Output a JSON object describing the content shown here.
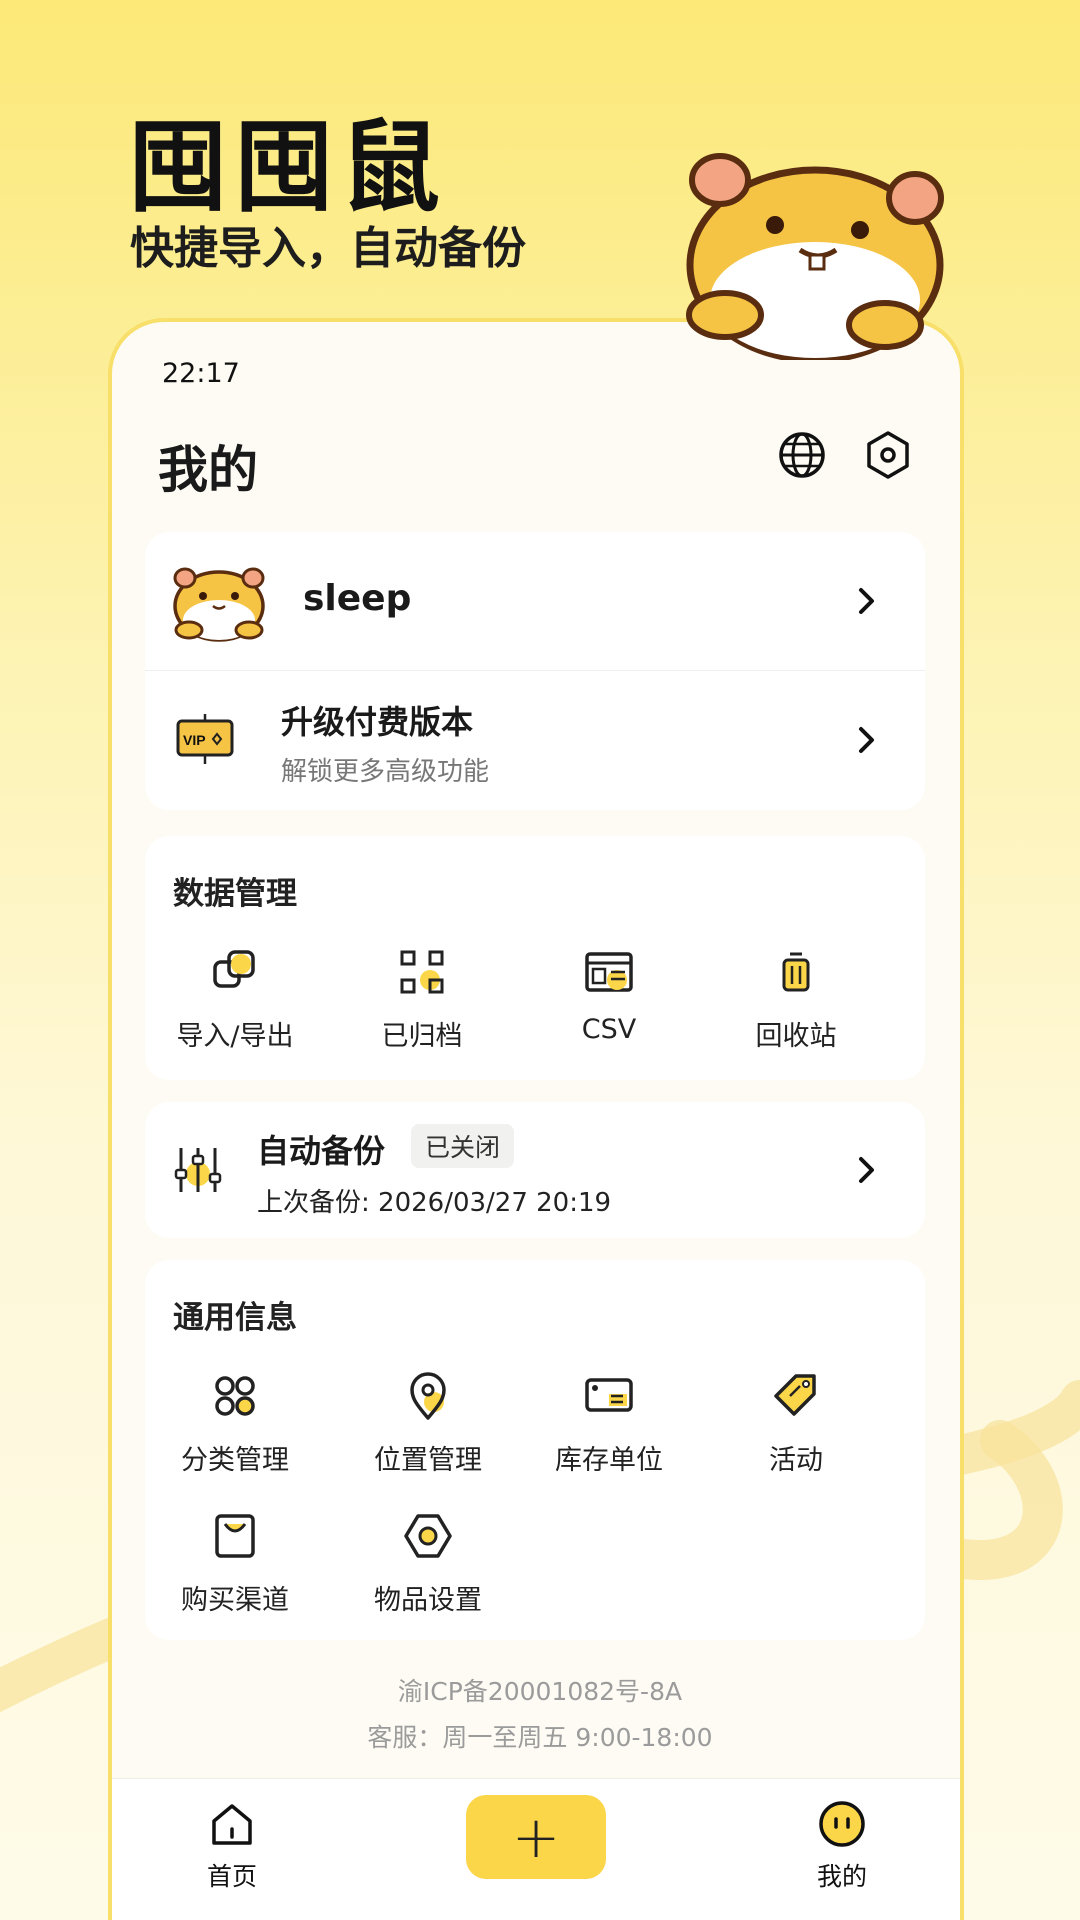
{
  "brand": {
    "title": "囤囤鼠",
    "subtitle": "快捷导入，自动备份"
  },
  "status": {
    "time": "22:17"
  },
  "header": {
    "title": "我的",
    "icons": [
      "globe-icon",
      "settings-hex-icon"
    ]
  },
  "profile": {
    "username": "sleep"
  },
  "upgrade": {
    "title": "升级付费版本",
    "subtitle": "解锁更多高级功能",
    "badge": "VIP"
  },
  "data_management": {
    "title": "数据管理",
    "items": [
      {
        "label": "导入/导出",
        "icon": "import-export-icon"
      },
      {
        "label": "已归档",
        "icon": "archive-icon"
      },
      {
        "label": "CSV",
        "icon": "csv-icon"
      },
      {
        "label": "回收站",
        "icon": "trash-icon"
      }
    ]
  },
  "backup": {
    "title": "自动备份",
    "status_badge": "已关闭",
    "last_backup": "上次备份: 2026/03/27 20:19"
  },
  "general": {
    "title": "通用信息",
    "items": [
      {
        "label": "分类管理",
        "icon": "category-icon"
      },
      {
        "label": "位置管理",
        "icon": "location-icon"
      },
      {
        "label": "库存单位",
        "icon": "unit-icon"
      },
      {
        "label": "活动",
        "icon": "tag-icon"
      },
      {
        "label": "购买渠道",
        "icon": "shopping-bag-icon"
      },
      {
        "label": "物品设置",
        "icon": "item-settings-icon"
      }
    ]
  },
  "footer": {
    "icp": "渝ICP备20001082号-8A",
    "service": "客服：周一至周五 9:00-18:00"
  },
  "tabbar": {
    "home": "首页",
    "add": "+",
    "mine": "我的"
  },
  "colors": {
    "accent": "#fbd649",
    "border": "#f7df6a",
    "hamster_orange": "#f6c444",
    "text": "#1a1a1a"
  }
}
